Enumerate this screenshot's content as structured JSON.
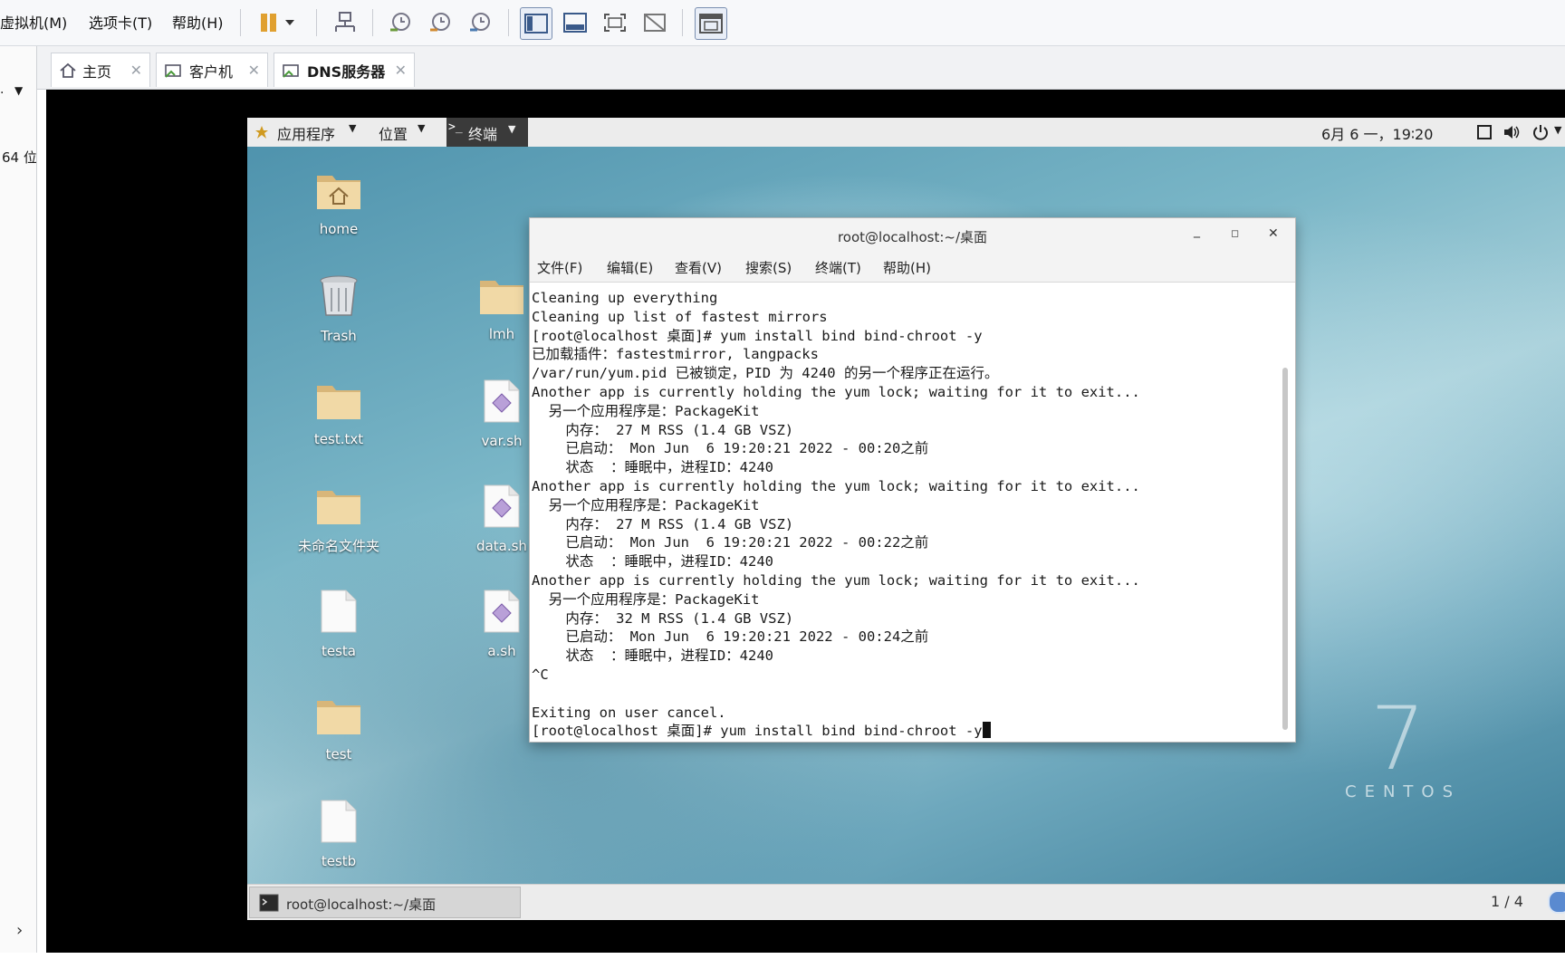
{
  "host": {
    "menus": [
      "虚拟机(M)",
      "选项卡(T)",
      "帮助(H)"
    ],
    "tabs": [
      {
        "label": "主页",
        "icon": "home-icon"
      },
      {
        "label": "客户机",
        "icon": "vm-icon"
      },
      {
        "label": "DNS服务器",
        "icon": "vm-icon"
      }
    ],
    "library_text": "64 位"
  },
  "gnome": {
    "applications": "应用程序",
    "places": "位置",
    "terminal_menu": "终端",
    "clock": "6月 6 一，19∶20",
    "taskbar_item": "root@localhost:~/桌面",
    "workspace": "1 / 4"
  },
  "desktop_icons": [
    {
      "label": "home",
      "type": "home-folder"
    },
    {
      "label": "Trash",
      "type": "trash"
    },
    {
      "label": "test.txt",
      "type": "folder"
    },
    {
      "label": "未命名文件夹",
      "type": "folder"
    },
    {
      "label": "testa",
      "type": "file"
    },
    {
      "label": "test",
      "type": "folder"
    },
    {
      "label": "testb",
      "type": "file"
    },
    {
      "label": "lmh",
      "type": "folder"
    },
    {
      "label": "var.sh",
      "type": "script"
    },
    {
      "label": "data.sh",
      "type": "script"
    },
    {
      "label": "a.sh",
      "type": "script"
    }
  ],
  "watermark": {
    "number": "7",
    "text": "CENTOS"
  },
  "terminal": {
    "title": "root@localhost:~/桌面",
    "menus": [
      "文件(F)",
      "编辑(E)",
      "查看(V)",
      "搜索(S)",
      "终端(T)",
      "帮助(H)"
    ],
    "lines": [
      "Cleaning up everything",
      "Cleaning up list of fastest mirrors",
      "[root@localhost 桌面]# yum install bind bind-chroot -y",
      "已加载插件：fastestmirror, langpacks",
      "/var/run/yum.pid 已被锁定，PID 为 4240 的另一个程序正在运行。",
      "Another app is currently holding the yum lock; waiting for it to exit...",
      "  另一个应用程序是：PackageKit",
      "    内存： 27 M RSS (1.4 GB VSZ)",
      "    已启动： Mon Jun  6 19:20:21 2022 - 00:20之前",
      "    状态  ：睡眠中，进程ID：4240",
      "Another app is currently holding the yum lock; waiting for it to exit...",
      "  另一个应用程序是：PackageKit",
      "    内存： 27 M RSS (1.4 GB VSZ)",
      "    已启动： Mon Jun  6 19:20:21 2022 - 00:22之前",
      "    状态  ：睡眠中，进程ID：4240",
      "Another app is currently holding the yum lock; waiting for it to exit...",
      "  另一个应用程序是：PackageKit",
      "    内存： 32 M RSS (1.4 GB VSZ)",
      "    已启动： Mon Jun  6 19:20:21 2022 - 00:24之前",
      "    状态  ：睡眠中，进程ID：4240",
      "^C",
      "",
      "Exiting on user cancel.",
      "[root@localhost 桌面]# yum install bind bind-chroot -y"
    ]
  },
  "colors": {
    "vm_background": "#000000",
    "toolbar_accent": "#e0a030",
    "desktop_blue": "#4f93ad"
  }
}
